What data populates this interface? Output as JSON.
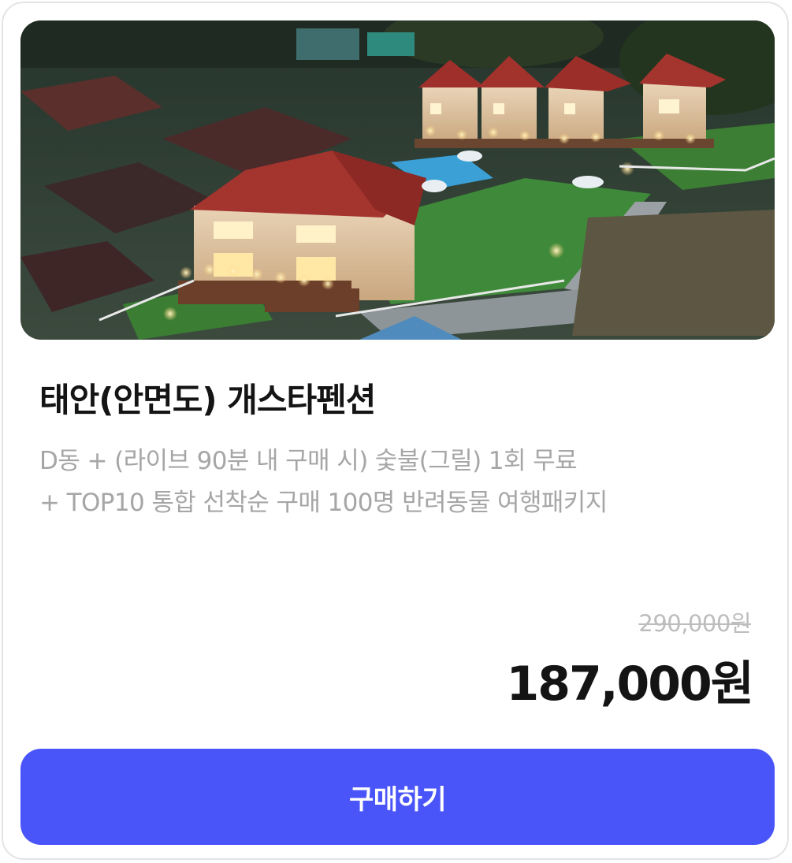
{
  "product": {
    "image_alt": "pension-aerial-photo",
    "title": "태안(안면도) 개스타펜션",
    "subtitle_line1": "D동 + (라이브 90분 내 구매 시) 숯불(그릴) 1회 무료",
    "subtitle_line2": "+ TOP10 통합 선착순 구매 100명 반려동물 여행패키지",
    "original_price": "290,000원",
    "sale_price": "187,000원"
  },
  "actions": {
    "buy_label": "구매하기"
  },
  "colors": {
    "accent": "#4a55f9",
    "title": "#141414",
    "subtitle": "#a6a6a6",
    "original_price": "#bdbdbd"
  }
}
